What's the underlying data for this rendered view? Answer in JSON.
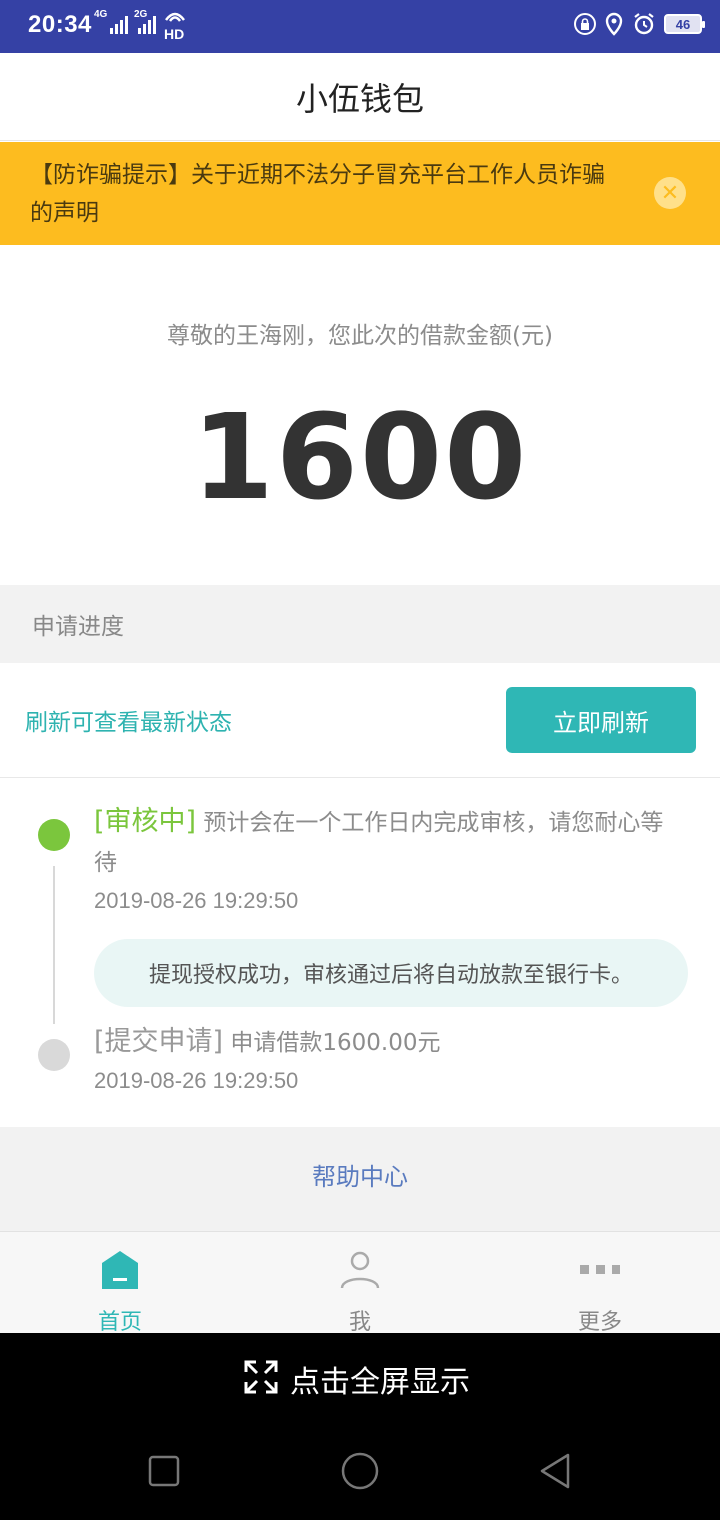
{
  "status_bar": {
    "time": "20:34",
    "net1": "4G",
    "net2": "2G",
    "hd": "HD",
    "battery": "46"
  },
  "header": {
    "title": "小伍钱包"
  },
  "notice": {
    "text": "【防诈骗提示】关于近期不法分子冒充平台工作人员诈骗的声明",
    "close_glyph": "✕"
  },
  "amount": {
    "label": "尊敬的王海刚，您此次的借款金额(元)",
    "value": "1600"
  },
  "progress": {
    "section_label": "申请进度",
    "refresh_hint": "刷新可查看最新状态",
    "refresh_button": "立即刷新",
    "steps": [
      {
        "tag": "[审核中]",
        "text": " 预计会在一个工作日内完成审核，请您耐心等待",
        "time": "2019-08-26 19:29:50",
        "bubble": "提现授权成功，审核通过后将自动放款至银行卡。"
      },
      {
        "tag": "[提交申请]",
        "text": " 申请借款1600.00元",
        "time": "2019-08-26 19:29:50"
      }
    ]
  },
  "help": {
    "label": "帮助中心"
  },
  "bottom_nav": {
    "items": [
      {
        "label": "首页",
        "icon": "home-icon"
      },
      {
        "label": "我",
        "icon": "user-icon"
      },
      {
        "label": "更多",
        "icon": "more-icon"
      }
    ]
  },
  "fullscreen": {
    "label": "点击全屏显示"
  },
  "colors": {
    "status_bar": "#3541a5",
    "notice": "#fdbc1f",
    "accent": "#2fb7b5",
    "active_step": "#7bc63d",
    "help_link": "#5a7bbf"
  }
}
